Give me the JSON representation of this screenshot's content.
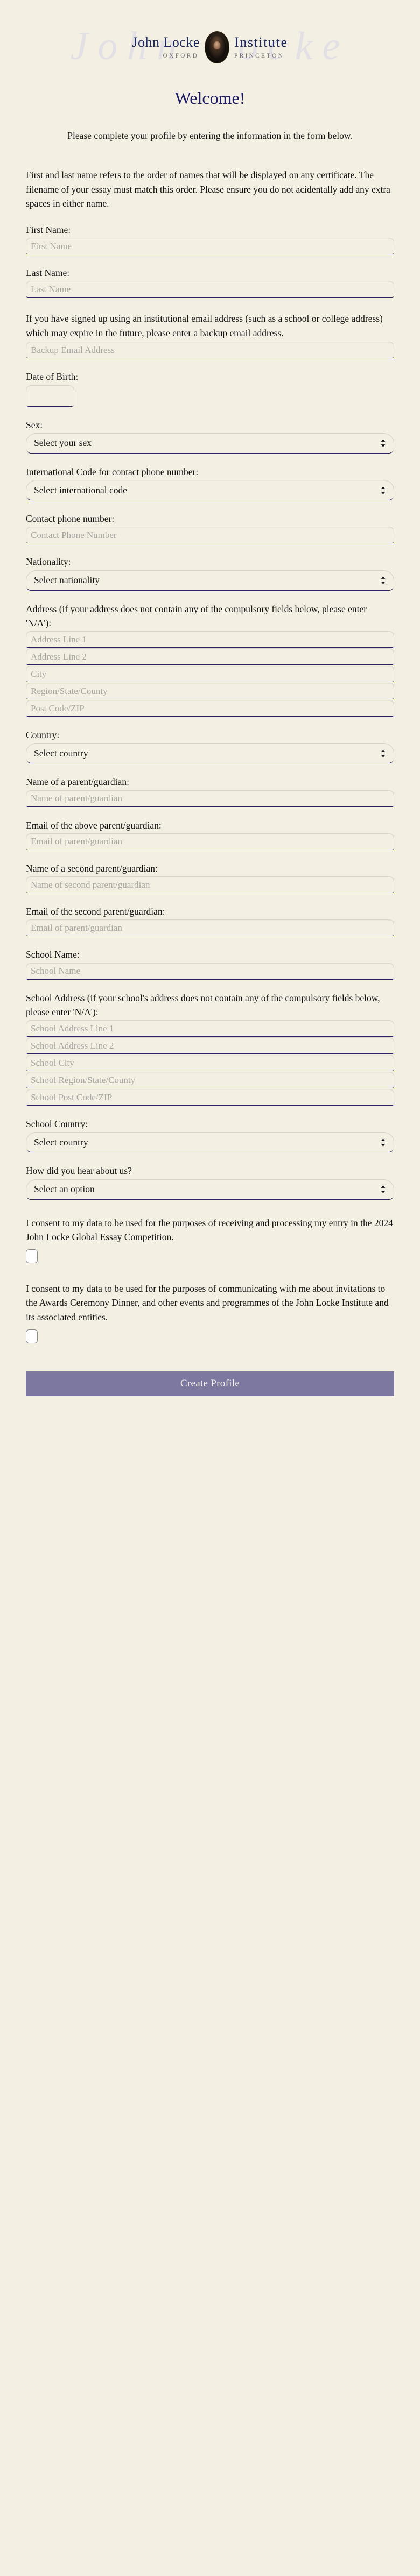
{
  "logo": {
    "name_left": "John Locke",
    "sub_left": "OXFORD",
    "name_right": "Institute",
    "sub_right": "PRINCETON",
    "watermark": "John Locke",
    "brand_navy": "#1c2a5e"
  },
  "header": {
    "title": "Welcome!",
    "subtitle": "Please complete your profile by entering the information in the form below."
  },
  "notes": {
    "name_note": "First and last name refers to the order of names that will be displayed on any certificate. The filename of your essay must match this order. Please ensure you do not acidentally add any extra spaces in either name.",
    "backup_email_note": "If you have signed up using an institutional email address (such as a school or college address) which may expire in the future, please enter a backup email address."
  },
  "fields": {
    "first_name": {
      "label": "First Name:",
      "placeholder": "First Name",
      "value": ""
    },
    "last_name": {
      "label": "Last Name:",
      "placeholder": "Last Name",
      "value": ""
    },
    "backup_email": {
      "placeholder": "Backup Email Address",
      "value": ""
    },
    "dob": {
      "label": "Date of Birth:",
      "value": ""
    },
    "sex": {
      "label": "Sex:",
      "selected": "Select your sex"
    },
    "intl_code": {
      "label": "International Code for contact phone number:",
      "selected": "Select international code"
    },
    "phone": {
      "label": "Contact phone number:",
      "placeholder": "Contact Phone Number",
      "value": ""
    },
    "nationality": {
      "label": "Nationality:",
      "selected": "Select nationality"
    },
    "address": {
      "label": "Address (if your address does not contain any of the compulsory fields below, please enter 'N/A'):",
      "line1": "Address Line 1",
      "line2": "Address Line 2",
      "city": "City",
      "region": "Region/State/County",
      "postcode": "Post Code/ZIP"
    },
    "country": {
      "label": "Country:",
      "selected": "Select country"
    },
    "parent_name": {
      "label": "Name of a parent/guardian:",
      "placeholder": "Name of parent/guardian",
      "value": ""
    },
    "parent_email": {
      "label": "Email of the above parent/guardian:",
      "placeholder": "Email of parent/guardian",
      "value": ""
    },
    "parent2_name": {
      "label": "Name of a second parent/guardian:",
      "placeholder": "Name of second parent/guardian",
      "value": ""
    },
    "parent2_email": {
      "label": "Email of the second parent/guardian:",
      "placeholder": "Email of parent/guardian",
      "value": ""
    },
    "school_name": {
      "label": "School Name:",
      "placeholder": "School Name",
      "value": ""
    },
    "school_address": {
      "label": "School Address (if your school's address does not contain any of the compulsory fields below, please enter 'N/A'):",
      "line1": "School Address Line 1",
      "line2": "School Address Line 2",
      "city": "School City",
      "region": "School Region/State/County",
      "postcode": "School Post Code/ZIP"
    },
    "school_country": {
      "label": "School Country:",
      "selected": "Select country"
    },
    "hear_about": {
      "label": "How did you hear about us?",
      "selected": "Select an option"
    }
  },
  "consents": {
    "first": "I consent to my data to be used for the purposes of receiving and processing my entry in the 2024 John Locke Global Essay Competition.",
    "second": "I consent to my data to be used for the purposes of communicating with me about invitations to the Awards Ceremony Dinner, and other events and programmes of the John Locke Institute and its associated entities."
  },
  "submit": {
    "label": "Create Profile",
    "color": "#7d789f"
  }
}
